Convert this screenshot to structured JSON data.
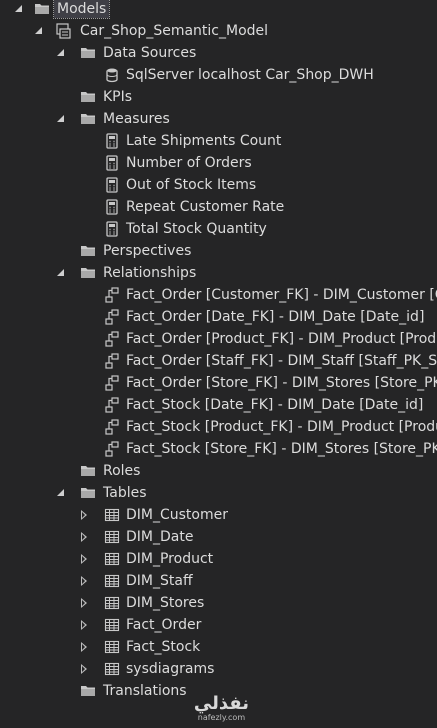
{
  "tree": {
    "root_label": "Models",
    "model_label": "Car_Shop_Semantic_Model",
    "data_sources": {
      "label": "Data Sources",
      "items": [
        "SqlServer localhost Car_Shop_DWH"
      ]
    },
    "kpis_label": "KPIs",
    "measures": {
      "label": "Measures",
      "items": [
        "Late Shipments Count",
        "Number of Orders",
        "Out of Stock Items",
        "Repeat Customer Rate",
        "Total Stock Quantity"
      ]
    },
    "perspectives_label": "Perspectives",
    "relationships": {
      "label": "Relationships",
      "items": [
        "Fact_Order [Customer_FK] - DIM_Customer [Cu",
        "Fact_Order [Date_FK] - DIM_Date [Date_id]",
        "Fact_Order [Product_FK] - DIM_Product [Produ",
        "Fact_Order [Staff_FK] - DIM_Staff [Staff_PK_SK",
        "Fact_Order [Store_FK] - DIM_Stores [Store_PK_",
        "Fact_Stock [Date_FK] - DIM_Date [Date_id]",
        "Fact_Stock [Product_FK] - DIM_Product [Produ",
        "Fact_Stock [Store_FK] - DIM_Stores [Store_PK_"
      ]
    },
    "roles_label": "Roles",
    "tables": {
      "label": "Tables",
      "items": [
        "DIM_Customer",
        "DIM_Date",
        "DIM_Product",
        "DIM_Staff",
        "DIM_Stores",
        "Fact_Order",
        "Fact_Stock",
        "sysdiagrams"
      ]
    },
    "translations_label": "Translations"
  },
  "watermark": {
    "arabic": "نفذلي",
    "latin": "nafezly.com"
  },
  "colors": {
    "background": "#252526",
    "text": "#dcdcdc",
    "folder": "#dcb67a",
    "measure_icon": "#c8c8c8",
    "relationship_icon": "#c8c8c8",
    "table_icon": "#c8c8c8"
  },
  "icons": {
    "folder": "folder-icon",
    "model": "model-icon",
    "datasource": "database-icon",
    "measure": "calculator-icon",
    "relationship": "relationship-icon",
    "table": "table-icon"
  }
}
